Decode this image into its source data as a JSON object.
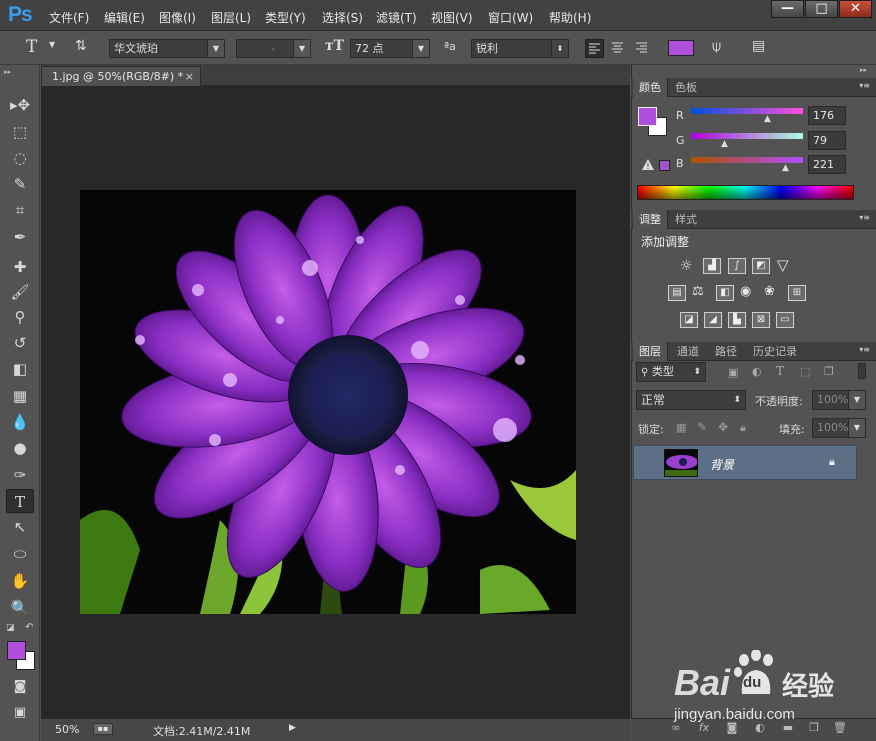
{
  "app": {
    "logo": "Ps"
  },
  "menu": [
    "文件(F)",
    "编辑(E)",
    "图像(I)",
    "图层(L)",
    "类型(Y)",
    "选择(S)",
    "滤镜(T)",
    "视图(V)",
    "窗口(W)",
    "帮助(H)"
  ],
  "window_buttons": {
    "minimize": "—",
    "maximize": "□",
    "close": "✕"
  },
  "options": {
    "tool_glyph": "T",
    "font_family": "华文琥珀",
    "font_style": "-",
    "font_size": "72 点",
    "aa_icon": "ªa",
    "antialias": "锐利",
    "text_color": "#b04fdd"
  },
  "document": {
    "tab_title": "1.jpg @ 50%(RGB/8#) *",
    "tab_close": "×"
  },
  "status": {
    "zoom": "50%",
    "doc_info": "文档:2.41M/2.41M",
    "arrow": "▶"
  },
  "color_panel": {
    "tabs": [
      "颜色",
      "色板"
    ],
    "foreground": "#b04fdd",
    "background": "#ffffff",
    "channels": [
      {
        "label": "R",
        "value": "176"
      },
      {
        "label": "G",
        "value": "79"
      },
      {
        "label": "B",
        "value": "221"
      }
    ],
    "warning": "!"
  },
  "adjustments_panel": {
    "tabs": [
      "调整",
      "样式"
    ],
    "title": "添加调整"
  },
  "layers_panel": {
    "tabs": [
      "图层",
      "通道",
      "路径",
      "历史记录"
    ],
    "filter_kind": "类型",
    "blend_mode": "正常",
    "opacity_label": "不透明度:",
    "opacity_value": "100%",
    "lock_label": "锁定:",
    "fill_label": "填充:",
    "fill_value": "100%",
    "layers": [
      {
        "name": "背景",
        "visible": true,
        "locked": true
      }
    ],
    "footer_icons": [
      "link-icon",
      "fx-icon",
      "mask-icon",
      "adjustment-icon",
      "folder-icon",
      "new-layer-icon",
      "trash-icon"
    ]
  },
  "watermark": {
    "brand": "Bai",
    "paw": "du",
    "cn": "经验",
    "url": "jingyan.baidu.com"
  }
}
